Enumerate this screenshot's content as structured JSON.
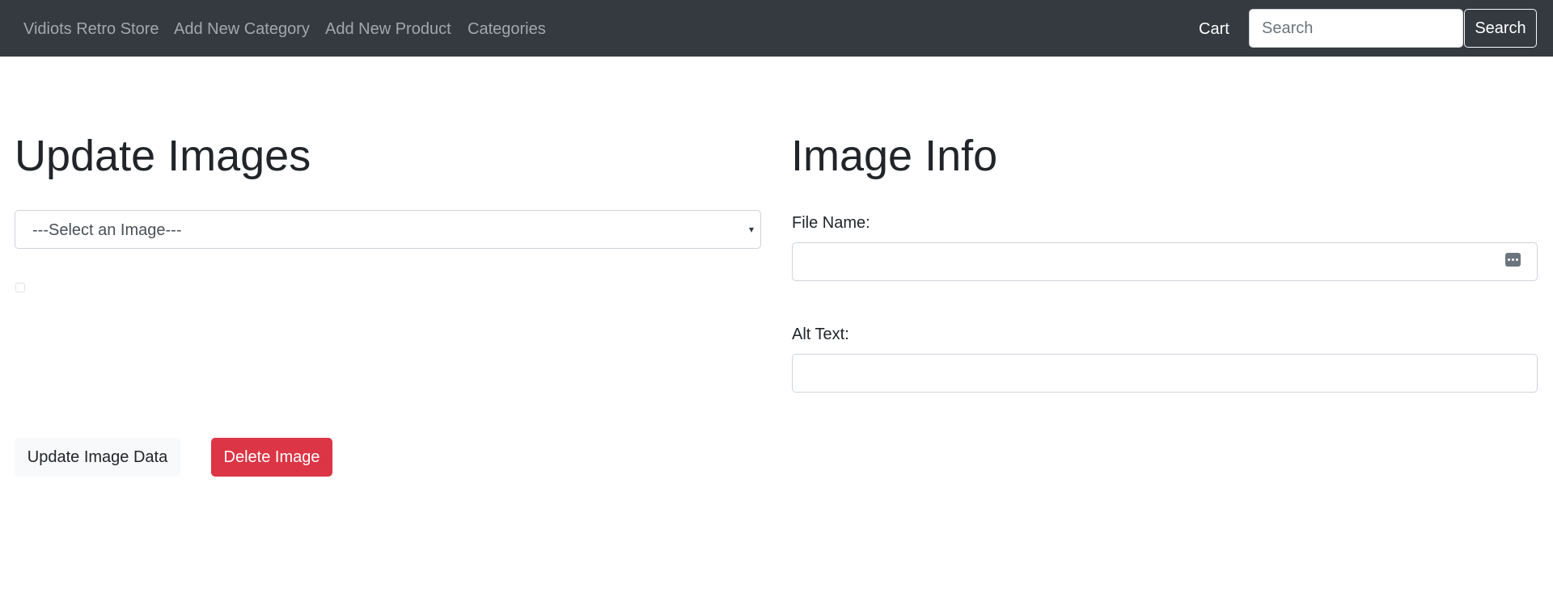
{
  "navbar": {
    "brand": "Vidiots Retro Store",
    "links": [
      "Add New Category",
      "Add New Product",
      "Categories"
    ],
    "cart": "Cart",
    "search_placeholder": "Search",
    "search_button": "Search"
  },
  "update_images": {
    "title": "Update Images",
    "select_value": "---Select an Image---",
    "update_button": "Update Image Data",
    "delete_button": "Delete Image"
  },
  "image_info": {
    "title": "Image Info",
    "file_name_label": "File Name:",
    "file_name_value": "",
    "alt_text_label": "Alt Text:",
    "alt_text_value": ""
  },
  "colors": {
    "navbar_bg": "#343a40",
    "danger": "#dc3545",
    "light": "#f8f9fa"
  }
}
